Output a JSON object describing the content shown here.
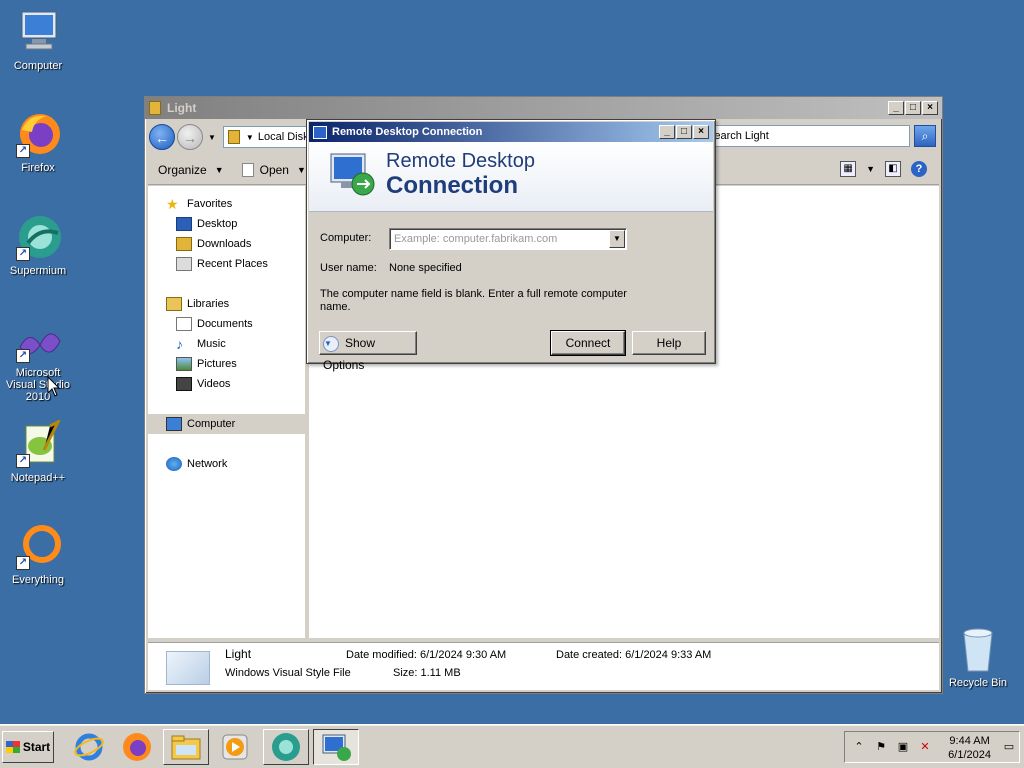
{
  "desktop_icons": [
    {
      "label": "Computer",
      "icon": "computer-icon"
    },
    {
      "label": "Firefox",
      "icon": "firefox-icon"
    },
    {
      "label": "Supermium",
      "icon": "supermium-icon"
    },
    {
      "label": "Microsoft Visual Studio 2010",
      "icon": "visual-studio-icon"
    },
    {
      "label": "Notepad++",
      "icon": "notepadpp-icon"
    },
    {
      "label": "Everything",
      "icon": "everything-icon"
    }
  ],
  "recycle_bin": {
    "label": "Recycle Bin"
  },
  "explorer": {
    "title": "Light",
    "address": "Local Disk",
    "search_placeholder": "Search Light",
    "commands": {
      "organize": "Organize",
      "open": "Open"
    },
    "nav": {
      "favorites": "Favorites",
      "desktop": "Desktop",
      "downloads": "Downloads",
      "recent_places": "Recent Places",
      "libraries": "Libraries",
      "documents": "Documents",
      "music": "Music",
      "pictures": "Pictures",
      "videos": "Videos",
      "computer": "Computer",
      "network": "Network"
    },
    "details": {
      "name": "Light",
      "type": "Windows Visual Style File",
      "date_modified": "Date modified: 6/1/2024 9:30 AM",
      "date_created": "Date created: 6/1/2024 9:33 AM",
      "size": "Size:  1.11 MB"
    }
  },
  "rdc": {
    "title": "Remote Desktop Connection",
    "banner_line1": "Remote Desktop",
    "banner_line2": "Connection",
    "computer_label": "Computer:",
    "computer_placeholder": "Example: computer.fabrikam.com",
    "username_label": "User name:",
    "username_value": "None specified",
    "message": "The computer name field is blank. Enter a full remote computer name.",
    "show_options": "Show Options",
    "connect": "Connect",
    "help": "Help"
  },
  "taskbar": {
    "start": "Start",
    "apps": [
      "internet-explorer-icon",
      "firefox-icon",
      "explorer-icon",
      "media-player-icon",
      "supermium-icon",
      "remote-desktop-icon"
    ],
    "clock_time": "9:44 AM",
    "clock_date": "6/1/2024"
  }
}
